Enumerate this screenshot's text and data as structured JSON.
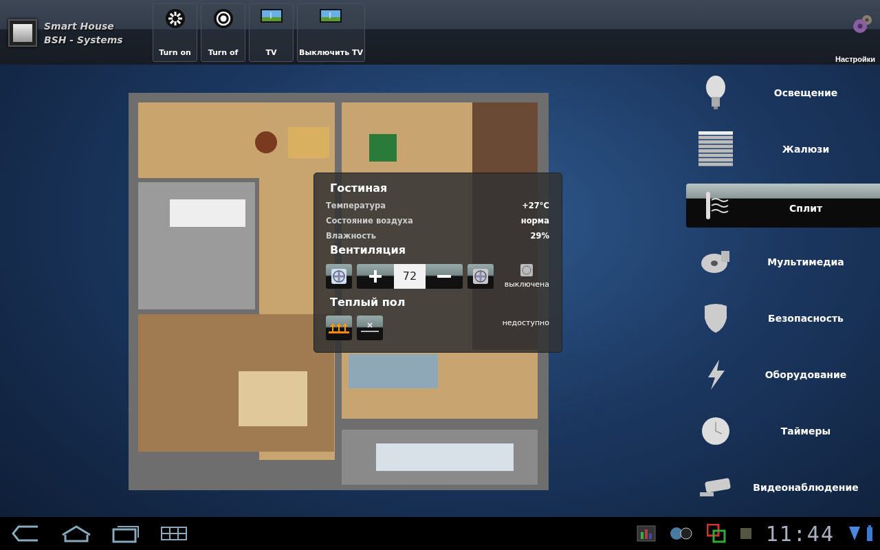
{
  "header": {
    "logo_lines": [
      "Smart House",
      "BSH - Systems"
    ],
    "actions": [
      {
        "label": "Turn on"
      },
      {
        "label": "Turn of"
      },
      {
        "label": "TV"
      },
      {
        "label": "Выключить TV"
      }
    ],
    "settings": {
      "label": "Настройки"
    }
  },
  "room_panel": {
    "title": "Гостиная",
    "readings": [
      {
        "label": "Температура",
        "value": "+27°C"
      },
      {
        "label": "Состояние воздуха",
        "value": "норма"
      },
      {
        "label": "Влажность",
        "value": "29%"
      }
    ],
    "ventilation": {
      "title": "Вентиляция",
      "value": "72",
      "status": "выключена"
    },
    "floor_heating": {
      "title": "Теплый пол",
      "status": "недоступно"
    }
  },
  "menu": [
    {
      "label": "Освещение",
      "selected": false
    },
    {
      "label": "Жалюзи",
      "selected": false
    },
    {
      "label": "Сплит",
      "selected": true
    },
    {
      "label": "Мультимедиа",
      "selected": false
    },
    {
      "label": "Безопасность",
      "selected": false
    },
    {
      "label": "Оборудование",
      "selected": false
    },
    {
      "label": "Таймеры",
      "selected": false
    },
    {
      "label": "Видеонаблюдение",
      "selected": false
    }
  ],
  "system_bar": {
    "clock": "11:44"
  }
}
